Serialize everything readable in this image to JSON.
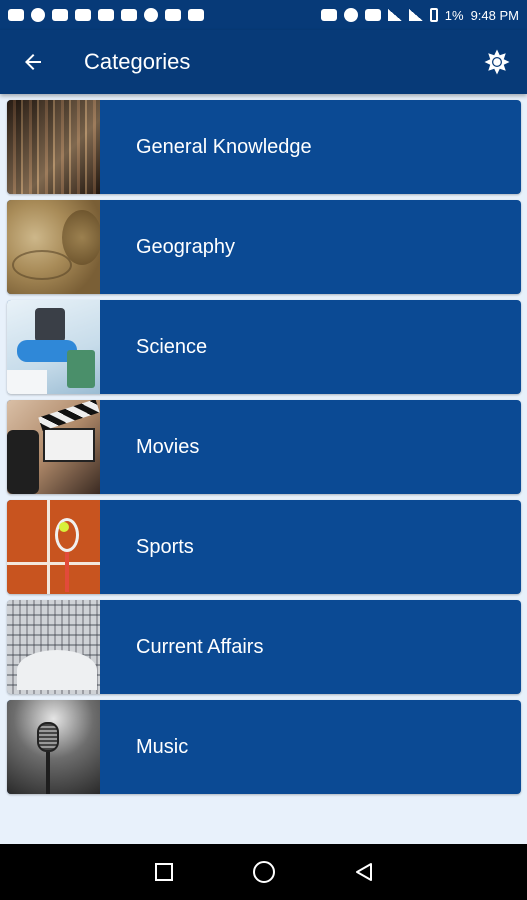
{
  "status_bar": {
    "battery_text": "1%",
    "time": "9:48 PM"
  },
  "app_bar": {
    "title": "Categories",
    "back_icon": "arrow-left-icon",
    "theme_icon": "brightness-icon"
  },
  "categories": [
    {
      "label": "General Knowledge",
      "image": "library-bookshelves"
    },
    {
      "label": "Geography",
      "image": "vintage-world-map"
    },
    {
      "label": "Science",
      "image": "lab-microscope"
    },
    {
      "label": "Movies",
      "image": "film-clapperboard"
    },
    {
      "label": "Sports",
      "image": "tennis-racket-clay-court"
    },
    {
      "label": "Current Affairs",
      "image": "library-atrium"
    },
    {
      "label": "Music",
      "image": "vintage-microphone"
    }
  ],
  "nav_bar": {
    "icons": [
      "recent-apps-icon",
      "home-icon",
      "back-triangle-icon"
    ]
  },
  "colors": {
    "primary": "#073a78",
    "card": "#0b4a94",
    "background": "#e8f1fb"
  }
}
